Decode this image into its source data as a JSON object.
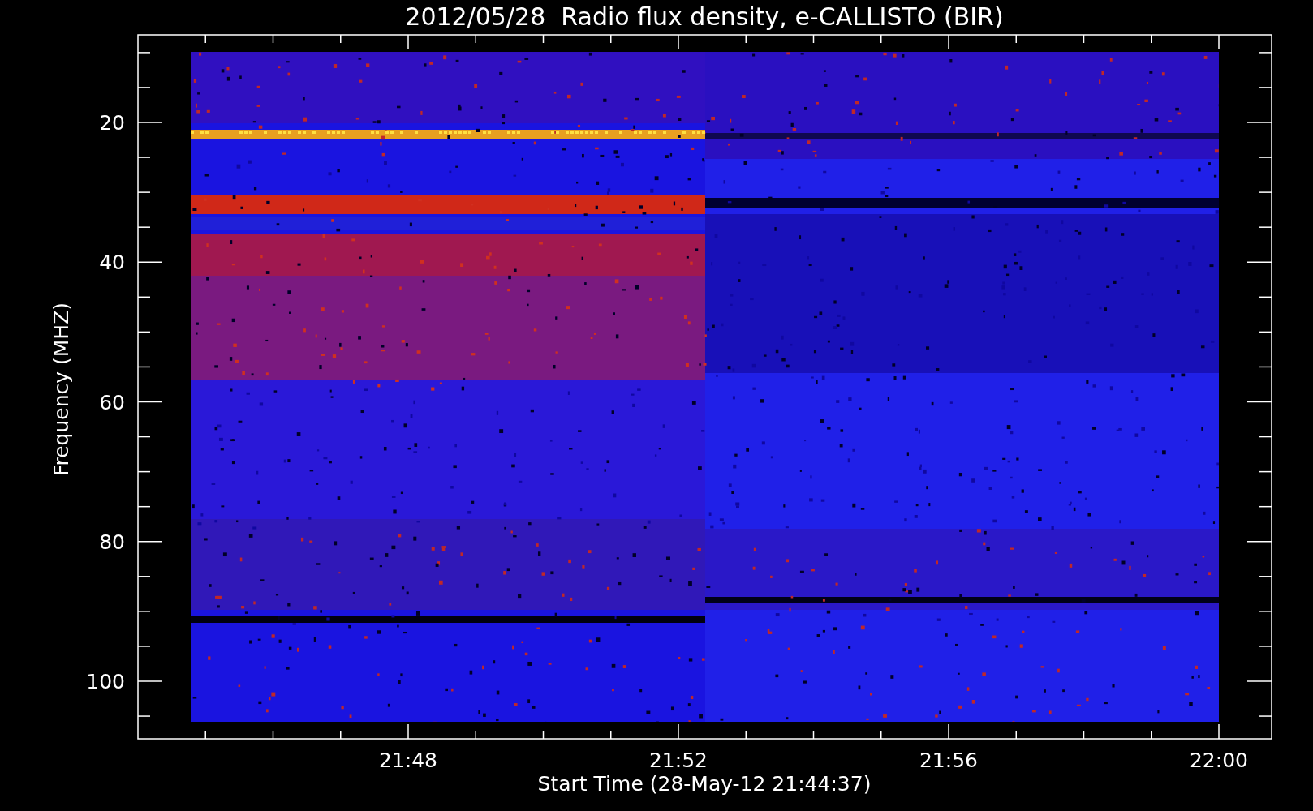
{
  "title": "2012/05/28  Radio flux density, e-CALLISTO (BIR)",
  "ylabel": "Frequency (MHZ)",
  "xlabel": "Start Time (28-May-12 21:44:37)",
  "yticks": [
    "20",
    "40",
    "60",
    "80",
    "100"
  ],
  "xticks": [
    "21:48",
    "21:52",
    "21:56",
    "22:00"
  ]
}
